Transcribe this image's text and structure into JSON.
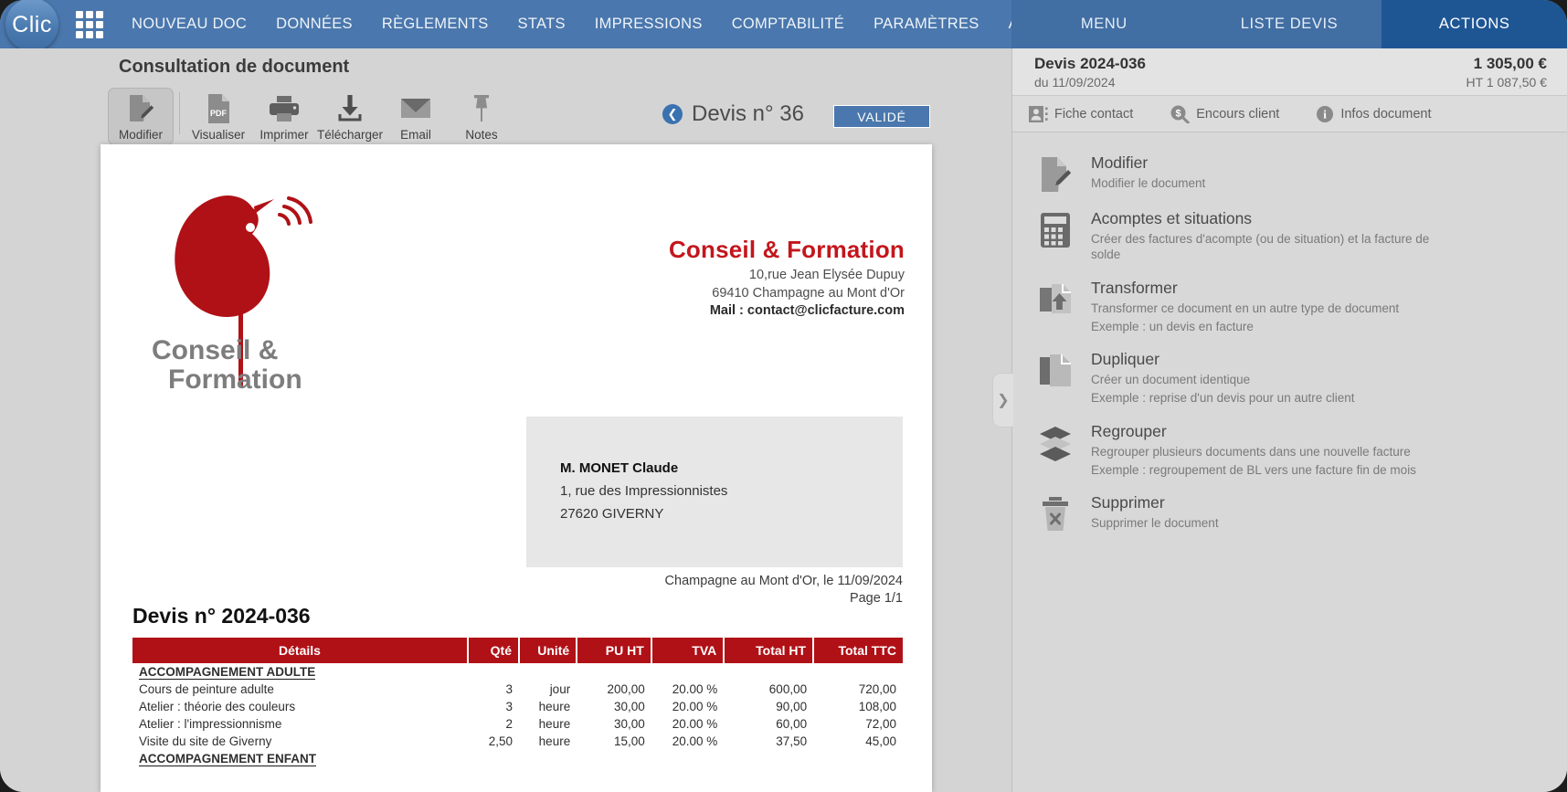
{
  "nav": {
    "logo": "Clic",
    "grid_icon": "apps-grid-icon",
    "items": [
      {
        "label": "NOUVEAU DOC"
      },
      {
        "label": "DONNÉES"
      },
      {
        "label": "RÈGLEMENTS"
      },
      {
        "label": "STATS"
      },
      {
        "label": "IMPRESSIONS"
      },
      {
        "label": "COMPTABILITÉ"
      },
      {
        "label": "PARAMÈTRES"
      },
      {
        "label": "AIDE"
      }
    ],
    "gamepad_icon": "gamepad-icon",
    "power_icon": "power-icon"
  },
  "panel_tabs": [
    {
      "label": "MENU",
      "active": false
    },
    {
      "label": "LISTE DEVIS",
      "active": false
    },
    {
      "label": "ACTIONS",
      "active": true
    }
  ],
  "main": {
    "page_title": "Consultation de document",
    "toolbar": [
      {
        "label": "Modifier",
        "icon": "document-pencil-icon",
        "active": true
      },
      {
        "label": "Visualiser",
        "icon": "pdf-file-icon",
        "active": false
      },
      {
        "label": "Imprimer",
        "icon": "printer-icon",
        "active": false
      },
      {
        "label": "Télécharger",
        "icon": "download-icon",
        "active": false
      },
      {
        "label": "Email",
        "icon": "envelope-icon",
        "active": false
      },
      {
        "label": "Notes",
        "icon": "pin-icon",
        "active": false
      }
    ],
    "doc_nav_label": "Devis  n° 36",
    "back_icon": "chevron-left-icon",
    "status_badge": "VALIDÉ",
    "accent_blue": "#4a77ad",
    "accent_red": "#b01116"
  },
  "document": {
    "logo_alt": "bird-logo",
    "logo_text_1": "Conseil &",
    "logo_text_2": "Formation",
    "company": {
      "name": "Conseil & Formation",
      "address_1": "10,rue Jean Elysée Dupuy",
      "address_2": "69410 Champagne au Mont d'Or",
      "mail": "Mail : contact@clicfacture.com"
    },
    "client": {
      "name": "M. MONET Claude",
      "address_1": "1, rue des Impressionnistes",
      "address_2": "27620 GIVERNY"
    },
    "place_date": "Champagne au Mont d'Or, le 11/09/2024",
    "page_label": "Page 1/1",
    "title": "Devis n° 2024-036",
    "table": {
      "columns": [
        "Détails",
        "Qté",
        "Unité",
        "PU HT",
        "TVA",
        "Total HT",
        "Total TTC"
      ],
      "rows": [
        {
          "type": "group",
          "label": "ACCOMPAGNEMENT ADULTE"
        },
        {
          "type": "item",
          "details": "Cours de peinture adulte",
          "qte": "3",
          "unite": "jour",
          "pu_ht": "200,00",
          "tva": "20.00 %",
          "total_ht": "600,00",
          "total_ttc": "720,00"
        },
        {
          "type": "item",
          "details": "Atelier : théorie des couleurs",
          "qte": "3",
          "unite": "heure",
          "pu_ht": "30,00",
          "tva": "20.00 %",
          "total_ht": "90,00",
          "total_ttc": "108,00"
        },
        {
          "type": "item",
          "details": "Atelier : l'impressionnisme",
          "qte": "2",
          "unite": "heure",
          "pu_ht": "30,00",
          "tva": "20.00 %",
          "total_ht": "60,00",
          "total_ttc": "72,00"
        },
        {
          "type": "item",
          "details": "Visite du site de Giverny",
          "qte": "2,50",
          "unite": "heure",
          "pu_ht": "15,00",
          "tva": "20.00 %",
          "total_ht": "37,50",
          "total_ttc": "45,00"
        },
        {
          "type": "group",
          "label": "ACCOMPAGNEMENT ENFANT"
        }
      ]
    }
  },
  "right_panel": {
    "header": {
      "doc_title": "Devis 2024-036",
      "doc_date": "du 11/09/2024",
      "amount_ttc": "1 305,00 €",
      "amount_ht": "HT 1 087,50 €"
    },
    "tabs": [
      {
        "label": "Fiche contact",
        "icon": "contact-card-icon"
      },
      {
        "label": "Encours client",
        "icon": "money-magnifier-icon"
      },
      {
        "label": "Infos document",
        "icon": "info-circle-icon"
      }
    ],
    "actions": [
      {
        "title": "Modifier",
        "icon": "document-pencil-icon",
        "desc": [
          "Modifier le document"
        ]
      },
      {
        "title": "Acomptes et situations",
        "icon": "calculator-icon",
        "desc": [
          "Créer des factures d'acompte (ou de situation) et la facture de solde"
        ]
      },
      {
        "title": "Transformer",
        "icon": "transform-arrow-icon",
        "desc": [
          "Transformer ce document en un autre type de document",
          "Exemple : un devis en facture"
        ]
      },
      {
        "title": "Dupliquer",
        "icon": "copy-documents-icon",
        "desc": [
          "Créer un document identique",
          "Exemple : reprise d'un devis pour un autre client"
        ]
      },
      {
        "title": "Regrouper",
        "icon": "layers-icon",
        "desc": [
          "Regrouper plusieurs documents dans une nouvelle facture",
          "Exemple : regroupement de BL vers une facture fin de mois"
        ]
      },
      {
        "title": "Supprimer",
        "icon": "trash-x-icon",
        "desc": [
          "Supprimer le document"
        ]
      }
    ],
    "collapse_icon": "chevron-right-icon"
  }
}
